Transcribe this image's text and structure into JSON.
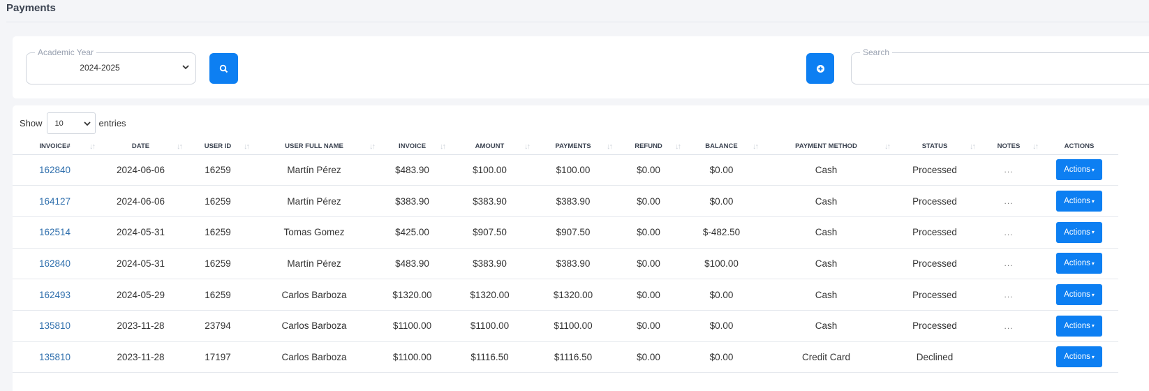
{
  "page": {
    "title": "Payments"
  },
  "filters": {
    "academic_year": {
      "legend": "Academic Year",
      "value": "2024-2025"
    },
    "search": {
      "legend": "Search",
      "value": ""
    }
  },
  "icons": {
    "search": "search-icon",
    "add": "plus-circle-icon",
    "dropdown": "chevron-down-icon",
    "sort": "sort-icon"
  },
  "colors": {
    "primary": "#0d7ff2",
    "link": "#2f6fad"
  },
  "length": {
    "show": "Show",
    "value": "10",
    "entries": "entries"
  },
  "table": {
    "columns": [
      "INVOICE#",
      "DATE",
      "USER ID",
      "USER FULL NAME",
      "INVOICE",
      "AMOUNT",
      "PAYMENTS",
      "REFUND",
      "BALANCE",
      "PAYMENT METHOD",
      "STATUS",
      "NOTES",
      "ACTIONS"
    ],
    "action_label": "Actions",
    "rows": [
      [
        "162840",
        "2024-06-06",
        "16259",
        "Martín Pérez",
        "$483.90",
        "$100.00",
        "$100.00",
        "$0.00",
        "$0.00",
        "Cash",
        "Processed",
        "...",
        "Actions"
      ],
      [
        "164127",
        "2024-06-06",
        "16259",
        "Martín Pérez",
        "$383.90",
        "$383.90",
        "$383.90",
        "$0.00",
        "$0.00",
        "Cash",
        "Processed",
        "...",
        "Actions"
      ],
      [
        "162514",
        "2024-05-31",
        "16259",
        "Tomas Gomez",
        "$425.00",
        "$907.50",
        "$907.50",
        "$0.00",
        "$-482.50",
        "Cash",
        "Processed",
        "...",
        "Actions"
      ],
      [
        "162840",
        "2024-05-31",
        "16259",
        "Martín Pérez",
        "$483.90",
        "$383.90",
        "$383.90",
        "$0.00",
        "$100.00",
        "Cash",
        "Processed",
        "...",
        "Actions"
      ],
      [
        "162493",
        "2024-05-29",
        "16259",
        "Carlos Barboza",
        "$1320.00",
        "$1320.00",
        "$1320.00",
        "$0.00",
        "$0.00",
        "Cash",
        "Processed",
        "...",
        "Actions"
      ],
      [
        "135810",
        "2023-11-28",
        "23794",
        "Carlos Barboza",
        "$1100.00",
        "$1100.00",
        "$1100.00",
        "$0.00",
        "$0.00",
        "Cash",
        "Processed",
        "...",
        "Actions"
      ],
      [
        "135810",
        "2023-11-28",
        "17197",
        "Carlos Barboza",
        "$1100.00",
        "$1116.50",
        "$1116.50",
        "$0.00",
        "$0.00",
        "Credit Card",
        "Declined",
        "",
        "Actions"
      ]
    ]
  }
}
